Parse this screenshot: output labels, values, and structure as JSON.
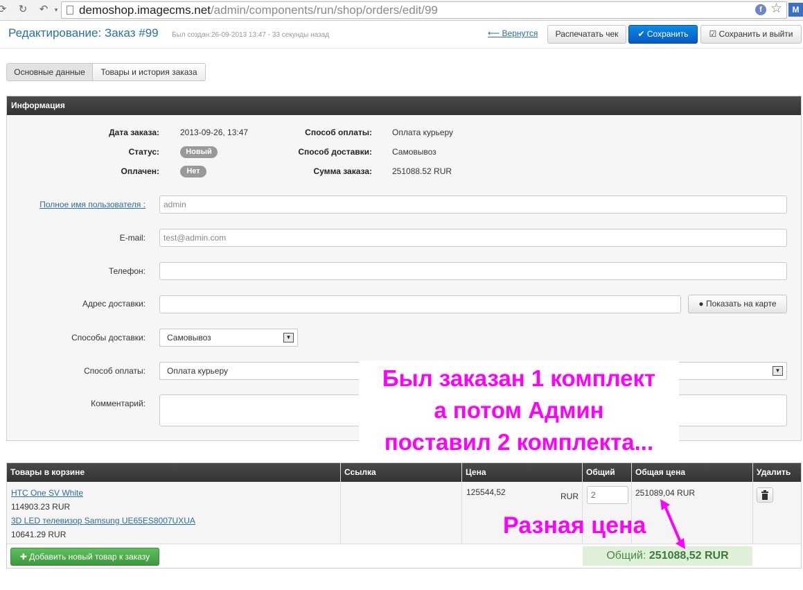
{
  "browser": {
    "url_host": "demoshop.imagecms.net",
    "url_path": "/admin/components/run/shop/orders/edit/99",
    "fb_label": "f",
    "mail_label": "M"
  },
  "header": {
    "title": "Редактирование: Заказ #99",
    "subtitle": "Был создан:26-09-2013 13:47 - 33 секунды назад",
    "back_arrow": "⟵",
    "back_label": "Вернутся",
    "print_label": "Распечатать чек",
    "save_label": "Сохранить",
    "save_exit_label": "Сохранить и выйти"
  },
  "tabs": {
    "main": "Основные данные",
    "goods": "Товары и история заказа"
  },
  "info": {
    "panel_title": "Информация",
    "order_date_label": "Дата заказа:",
    "order_date": "2013-09-26, 13:47",
    "status_label": "Статус:",
    "status": "Новый",
    "paid_label": "Оплачен:",
    "paid": "Нет",
    "payment_method_label": "Способ оплаты:",
    "payment_method": "Оплата курьеру",
    "delivery_method_label": "Способ доставки:",
    "delivery_method": "Самовывоз",
    "order_sum_label": "Сумма заказа:",
    "order_sum": "251088.52 RUR"
  },
  "form": {
    "fullname_label": "Полное имя пользователя",
    "fullname_colon": " :",
    "fullname_value": "admin",
    "email_label": "E-mail:",
    "email_value": "test@admin.com",
    "phone_label": "Телефон:",
    "phone_value": "",
    "address_label": "Адрес доставки:",
    "address_value": "",
    "map_button": "Показать на карте",
    "delivery_label": "Способы доставки:",
    "delivery_value": "Самовывоз",
    "payment_label": "Способ оплаты:",
    "payment_value": "Оплата курьеру",
    "comment_label": "Комментарий:"
  },
  "cart": {
    "columns": [
      "Товары в корзине",
      "Ссылка",
      "Цена",
      "Общий",
      "Общая цена",
      "Удалить"
    ],
    "items": [
      {
        "name": "HTC One SV White",
        "price": "114903.23 RUR"
      },
      {
        "name": "3D LED телевизор Samsung UE65ES8007UXUA",
        "price": "10641.29 RUR"
      }
    ],
    "row_price": "125544,52",
    "row_currency": "RUR",
    "row_qty": "2",
    "row_total": "251089,04 RUR",
    "add_button": "Добавить новый товар к заказу",
    "total_label": "Общий:",
    "total_value": "251088,52 RUR"
  },
  "annotations": {
    "note_line1": "Был заказан 1 комплект",
    "note_line2": "а потом Админ",
    "note_line3": "поставил 2 комплекта...",
    "diff_note": "Разная цена",
    "color": "#ff00ff"
  }
}
